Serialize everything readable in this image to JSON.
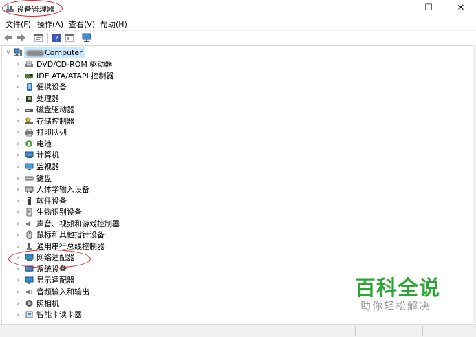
{
  "window": {
    "title": "设备管理器",
    "min_glyph": "—",
    "max_glyph": "☐",
    "close_glyph": "✕"
  },
  "menu": [
    "文件(F)",
    "操作(A)",
    "查看(V)",
    "帮助(H)"
  ],
  "tree": {
    "root": {
      "label_suffix": "Computer",
      "icon": "computer-icon",
      "expander": "∨"
    },
    "collapsed_glyph": "›",
    "items": [
      {
        "label": "DVD/CD-ROM 驱动器",
        "icon": "dvd-drive-icon"
      },
      {
        "label": "IDE ATA/ATAPI 控制器",
        "icon": "ide-controller-icon"
      },
      {
        "label": "便携设备",
        "icon": "portable-device-icon"
      },
      {
        "label": "处理器",
        "icon": "processor-icon"
      },
      {
        "label": "磁盘驱动器",
        "icon": "disk-drive-icon"
      },
      {
        "label": "存储控制器",
        "icon": "storage-controller-icon"
      },
      {
        "label": "打印队列",
        "icon": "printer-icon"
      },
      {
        "label": "电池",
        "icon": "battery-icon"
      },
      {
        "label": "计算机",
        "icon": "computer-icon"
      },
      {
        "label": "监视器",
        "icon": "monitor-icon"
      },
      {
        "label": "键盘",
        "icon": "keyboard-icon"
      },
      {
        "label": "人体学输入设备",
        "icon": "hid-icon"
      },
      {
        "label": "软件设备",
        "icon": "software-device-icon"
      },
      {
        "label": "生物识别设备",
        "icon": "biometric-icon"
      },
      {
        "label": "声音、视频和游戏控制器",
        "icon": "speaker-icon"
      },
      {
        "label": "鼠标和其他指针设备",
        "icon": "mouse-icon"
      },
      {
        "label": "通用串行总线控制器",
        "icon": "usb-icon"
      },
      {
        "label": "网络适配器",
        "icon": "network-adapter-icon"
      },
      {
        "label": "系统设备",
        "icon": "system-device-icon"
      },
      {
        "label": "显示适配器",
        "icon": "display-adapter-icon"
      },
      {
        "label": "音频输入和输出",
        "icon": "audio-io-icon"
      },
      {
        "label": "照相机",
        "icon": "camera-icon"
      },
      {
        "label": "智能卡读卡器",
        "icon": "smartcard-reader-icon"
      }
    ]
  },
  "watermark": {
    "main": "百科全说",
    "sub": "助你轻松解决"
  },
  "colors": {
    "highlight_ellipse": "#d8232a",
    "watermark_green": "#2aa632",
    "selection_bg": "#cce8ff"
  }
}
